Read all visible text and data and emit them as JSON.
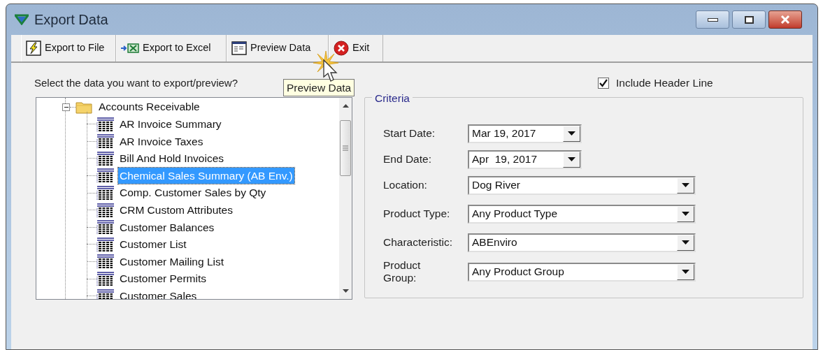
{
  "window": {
    "title": "Export Data"
  },
  "toolbar": {
    "buttons": [
      {
        "label": "Export to File",
        "kind": "file"
      },
      {
        "label": "Export to Excel",
        "kind": "excel"
      },
      {
        "label": "Preview Data",
        "kind": "preview"
      },
      {
        "label": "Exit",
        "kind": "exit"
      }
    ]
  },
  "tooltip": "Preview Data",
  "prompt": "Select the data you want to export/preview?",
  "include_header": {
    "label": "Include Header Line",
    "checked": true
  },
  "tree": {
    "label": "Accounts Receivable",
    "expanded": true,
    "children": [
      {
        "label": "AR Invoice Summary",
        "selected": false
      },
      {
        "label": "AR Invoice Taxes",
        "selected": false
      },
      {
        "label": "Bill And Hold Invoices",
        "selected": false
      },
      {
        "label": "Chemical Sales Summary (AB Env.)",
        "selected": true
      },
      {
        "label": "Comp. Customer Sales by Qty",
        "selected": false
      },
      {
        "label": "CRM Custom Attributes",
        "selected": false
      },
      {
        "label": "Customer Balances",
        "selected": false
      },
      {
        "label": "Customer List",
        "selected": false
      },
      {
        "label": "Customer Mailing List",
        "selected": false
      },
      {
        "label": "Customer Permits",
        "selected": false
      },
      {
        "label": "Customer Sales",
        "selected": false
      }
    ]
  },
  "criteria": {
    "title": "Criteria",
    "fields": [
      {
        "label": "Start Date:",
        "value": "Mar 19, 2017",
        "kind": "date"
      },
      {
        "label": "End Date:",
        "value": "Apr  19, 2017",
        "kind": "date"
      },
      {
        "label": "Location:",
        "value": "Dog River",
        "kind": "combo"
      },
      {
        "label": "Product Type:",
        "value": "Any Product Type",
        "kind": "combo"
      },
      {
        "label": "Characteristic:",
        "value": "ABEnviro",
        "kind": "combo"
      },
      {
        "label": "Product Group:",
        "value": "Any Product Group",
        "kind": "combo"
      }
    ]
  }
}
